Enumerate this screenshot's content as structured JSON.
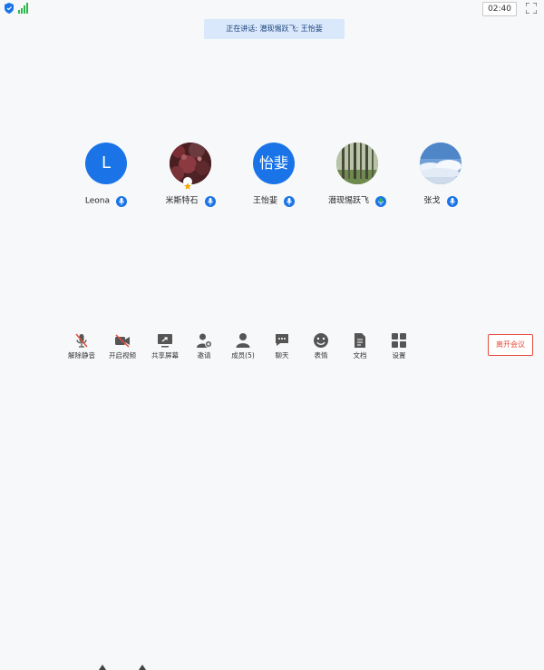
{
  "status": {
    "clock": "02:40",
    "speaking_label": "正在讲话: 潜现惕跃飞; 王怡婓"
  },
  "participants": [
    {
      "name": "Leona",
      "initials": "L",
      "avatar_type": "initial",
      "mic": "active"
    },
    {
      "name": "米斯特石",
      "avatar_type": "photo-red-foliage",
      "mic": "active",
      "host": true
    },
    {
      "name": "王怡婓",
      "initials": "怡婓",
      "avatar_type": "initial",
      "mic": "active"
    },
    {
      "name": "潜现惕跃飞",
      "avatar_type": "photo-forest",
      "mic": "speaking"
    },
    {
      "name": "张戈",
      "avatar_type": "photo-sky",
      "mic": "active"
    }
  ],
  "toolbar": {
    "unmute": "解除静音",
    "start_video": "开启视频",
    "share_screen": "共享屏幕",
    "invite": "邀请",
    "members": "成员(5)",
    "chat": "聊天",
    "reactions": "表情",
    "documents": "文档",
    "settings": "设置",
    "leave": "离开会议"
  },
  "colors": {
    "accent": "#1a74e8",
    "leave_red": "#e74c3c",
    "speaking_mic": "#2db84d",
    "banner_bg": "#d9e8fb"
  }
}
